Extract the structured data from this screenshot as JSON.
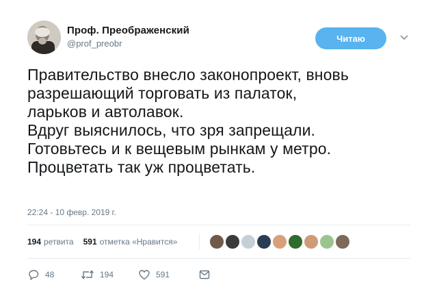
{
  "author": {
    "name": "Проф. Преображенский",
    "handle": "@prof_preobr"
  },
  "follow_button": {
    "label": "Читаю"
  },
  "tweet": {
    "lines": [
      "Правительство внесло законопроект, вновь",
      "разрешающий торговать из палаток,",
      "ларьков и автолавок.",
      "Вдруг выяснилось, что зря запрещали.",
      "Готовьтесь и к вещевым рынкам у метро.",
      "Процветать так уж процветать."
    ],
    "timestamp": "22:24 - 10 февр. 2019 г."
  },
  "stats": {
    "retweets_count": "194",
    "retweets_label": "ретвита",
    "likes_count": "591",
    "likes_label": "отметка «Нравится»"
  },
  "liker_avatars": [
    {
      "color": "#6f5a4c"
    },
    {
      "color": "#3b3b3b"
    },
    {
      "color": "#c7cfd6"
    },
    {
      "color": "#2b3d55"
    },
    {
      "color": "#d8a07a"
    },
    {
      "color": "#2f6b2c"
    },
    {
      "color": "#cf9a7a"
    },
    {
      "color": "#9cc48e"
    },
    {
      "color": "#7d6a5a"
    }
  ],
  "actions": {
    "replies": "48",
    "retweets": "194",
    "likes": "591"
  },
  "colors": {
    "accent": "#58b3ef",
    "muted": "#657786",
    "text": "#14171a"
  }
}
